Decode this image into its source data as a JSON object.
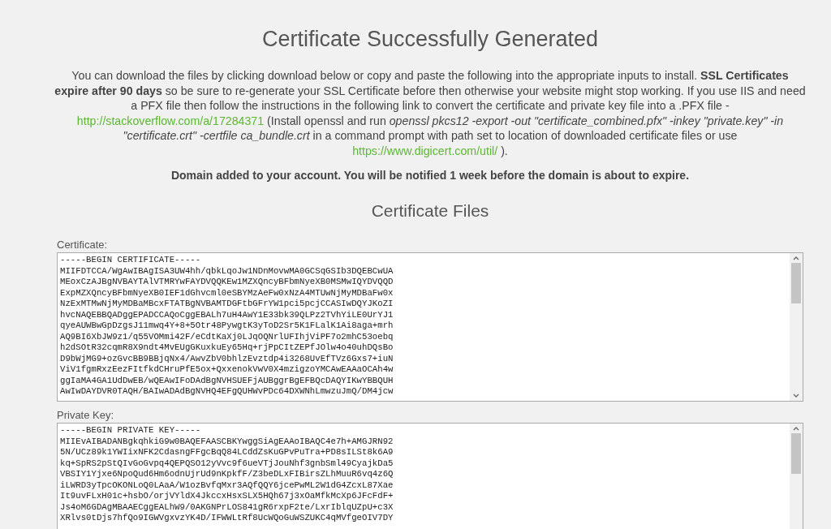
{
  "title": "Certificate Successfully Generated",
  "intro": [
    {
      "kind": "text",
      "text": "You can download the files by clicking download below or copy and paste the following into the appropriate inputs to install. **SSL Certificates expire after 90 days** so be sure to re-generate your SSL Certificate before then otherwise your website might stop working. If you use IIS and need a PFX file then follow the instructions in the following link to convert the certificate and private key file into a .PFX file -"
    },
    {
      "kind": "link",
      "text": "http://stackoverflow.com/a/17284371"
    },
    {
      "kind": "text",
      "text": "(Install openssl and run *openssl pkcs12 -export -out \"certificate_combined.pfx\" -inkey \"private.key\" -in \"certificate.crt\" -certfile ca_bundle.crt* in a command prompt with path set to location of downloaded certificate files or use"
    },
    {
      "kind": "link",
      "text": "https://www.digicert.com/util/"
    },
    {
      "kind": "text",
      "text": ")."
    }
  ],
  "notice": "Domain added to your account. You will be notified 1 week before the domain is about to expire.",
  "files_heading": "Certificate Files",
  "files": [
    {
      "label": "Certificate:",
      "lines": [
        "-----BEGIN CERTIFICATE-----",
        "MIIFDTCCA/WgAwIBAgISA3UW4hh/qbkLqoJw1NDnMovwMA0GCSqGSIb3DQEBCwUA",
        "MEoxCzAJBgNVBAYTAlVTMRYwFAYDVQQKEw1MZXQncyBFbmNyeXB0MSMwIQYDVQQD",
        "ExpMZXQncyBFbmNyeXB0IEF1dGhvcml0eSBYMzAeFw0xNzA4MTUwNjMyMDBaFw0x",
        "NzExMTMwNjMyMDBaMBcxFTATBgNVBAMTDGFtbGFrYW1pci5pcjCCASIwDQYJKoZI",
        "hvcNAQEBBQADggEPADCCAQoCggEBALh7uH4AwY1E33bk39QLPz2TVhYiLE0UrYJ1",
        "qyeAUWBwGpDzgsJ11mwq4Y+8+5Otr48PywgtK3yToD2Sr5K1FLalK1Ai8aga+mrh",
        "AQ9BI6XbJW9z1/q55VOMmi42F/eCdtKaXj0LJqOQNrlUFIhjViPF7o2mhC53oebq",
        "h2dSOtR32cqmR8X9ndt4MvEUgGKuxkuEy65Hq+rjPpCItZEPfJOlw4o40uhDQsBo",
        "D9bWjMG9+ozGvcBB9BBjqNx4/AwvZbV0bhlzEvztdp4i3268UvEfTVz6Gxs7+iuN",
        "ViV1fgmRxzEezFItfkdCHruPfE5ox+QxxenokVwV0X4mzigzoYMCAwEAAaOCAh4w",
        "ggIaMA4GA1UdDwEB/wQEAwIFoDAdBgNVHSUEFjAUBggrBgEFBQcDAQYIKwYBBQUH",
        "AwIwDAYDVR0TAQH/BAIwADAdBgNVHQ4EFgQUHWvPDc64DXWNhLmwzuJmQ/DM4jcw"
      ]
    },
    {
      "label": "Private Key:",
      "lines": [
        "-----BEGIN PRIVATE KEY-----",
        "MIIEvAIBADANBgkqhkiG9w0BAQEFAASCBKYwggSiAgEAAoIBAQC4e7h+AMGJRN92",
        "5N/UCz89k1YWIixNFK2CdasngFFgcBqQ84LCddZsKuGPvPuTra+PD8sILSt8k6A9",
        "kq+SpRS2pStQIvGoGvpq4QEPQSO12yVvc9f6ueVTjJouNhf3gnbSml49CyajkDa5",
        "VBSIY1Yjxe6NpoQud6Hm6odnUjrUd9nKpkfF/Z3beDLxFIBirsZLhMuuR6vq4z6Q",
        "iLWRD3yTpcOKONLoQ0LAaA/W1ozBvfqMxr3AQfQQY6jcePwML2W1dG4ZcxL87Xae",
        "It9uvFLxH01c+hsbO/orjVYldX4JkccxHsxSLX5HQh67j3xOaMfkMcXp6JFcFdF+",
        "Js4oM6GDAgMBAAECggEALhW9/0AKGNPrLOS841gR6rxpF2te/LxrIblqUZpU+c3X",
        "XRlvs0tDjs7hfQo9IGWVgxvzYK4D/IFWWLtRf8UcWQoGuWSZUKC4qMVfgeOIV7DY"
      ]
    }
  ]
}
